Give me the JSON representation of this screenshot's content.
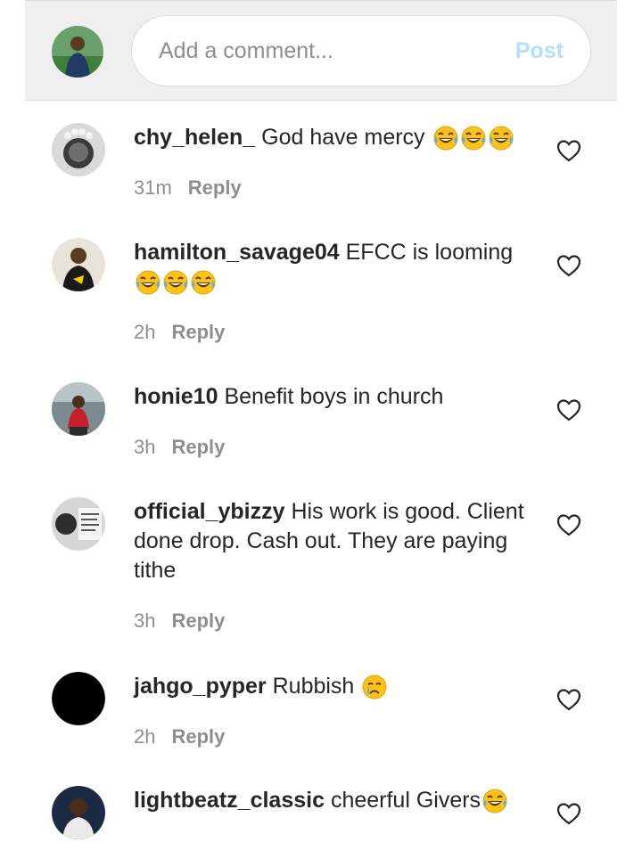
{
  "composer": {
    "placeholder": "Add a comment...",
    "post_label": "Post"
  },
  "comments": [
    {
      "username": "chy_helen_",
      "text": "God have mercy",
      "emoji": [
        "laughing-tears-emoji",
        "laughing-tears-emoji",
        "laughing-tears-emoji"
      ],
      "time": "31m",
      "reply": "Reply"
    },
    {
      "username": "hamilton_savage04",
      "text": "EFCC is looming",
      "emoji": [
        "laughing-tears-emoji",
        "laughing-tears-emoji",
        "laughing-tears-emoji"
      ],
      "time": "2h",
      "reply": "Reply"
    },
    {
      "username": "honie10",
      "text": "Benefit boys in church",
      "emoji": [],
      "time": "3h",
      "reply": "Reply"
    },
    {
      "username": "official_ybizzy",
      "text": "His work is good. Client done drop. Cash out. They are paying tithe",
      "emoji": [],
      "time": "3h",
      "reply": "Reply"
    },
    {
      "username": "jahgo_pyper",
      "text": "Rubbish",
      "emoji": [
        "crying-emoji"
      ],
      "time": "2h",
      "reply": "Reply"
    },
    {
      "username": "lightbeatz_classic",
      "text": "cheerful Givers",
      "emoji": [
        "laughing-tears-emoji"
      ],
      "time": "",
      "reply": ""
    }
  ],
  "colors": {
    "secondary_text": "#8e8e8e",
    "post_disabled": "#b2dffc",
    "header_bg": "#efefef"
  }
}
